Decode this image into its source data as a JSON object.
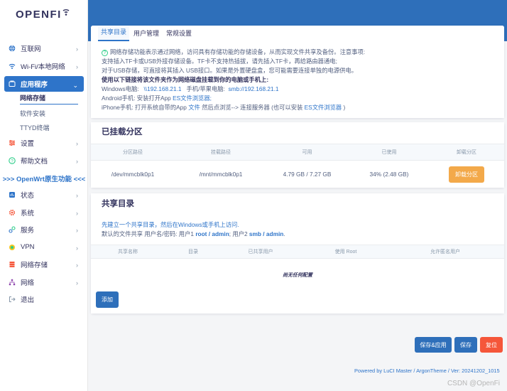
{
  "brand": {
    "name": "OPENFI"
  },
  "sidebar": {
    "items_top": [
      {
        "label": "互联网",
        "icon": "globe-icon"
      },
      {
        "label": "Wi-Fi/本地网络",
        "icon": "wifi-icon"
      }
    ],
    "active": {
      "label": "应用程序",
      "icon": "app-icon"
    },
    "sub_items": [
      {
        "label": "网络存储",
        "current": true
      },
      {
        "label": "软件安装"
      },
      {
        "label": "TTYD终端"
      }
    ],
    "items_mid": [
      {
        "label": "设置",
        "icon": "settings-icon"
      },
      {
        "label": "帮助文档",
        "icon": "help-icon"
      }
    ],
    "native_divider": ">>> OpenWrt原生功能 <<<",
    "items_native": [
      {
        "label": "状态",
        "icon": "status-icon"
      },
      {
        "label": "系统",
        "icon": "system-icon"
      },
      {
        "label": "服务",
        "icon": "services-icon"
      },
      {
        "label": "VPN",
        "icon": "vpn-icon"
      },
      {
        "label": "网络存储",
        "icon": "storage-icon"
      },
      {
        "label": "网络",
        "icon": "network-icon"
      },
      {
        "label": "退出",
        "icon": "logout-icon"
      }
    ]
  },
  "tabs": [
    "共享目录",
    "用户管理",
    "常规设置"
  ],
  "notice": {
    "line1": "网络存储功能表示通过网络，访问具有存储功能的存储设备，从而实现文件共享及备份。注意事项:",
    "line2": "支持插入TF卡或USB外接存储设备。TF卡不支持热插拔，请先插入TF卡，再给路由器通电;",
    "line3": "对于USB存储，可直接将其插入 USB接口。如果是外置硬盘盒，您可能需要连接单独的电源供电。",
    "line4": "使用以下链接将该文件夹作为网络磁盘挂载到你的电脑或手机上:",
    "win_label": "Windows电脑:",
    "win_path": "\\\\192.168.21.1",
    "phone_label": "手机/苹果电脑:",
    "phone_path": "smb://192.168.21.1",
    "android_prefix": "Android手机: 安装打开App",
    "android_link": "ES文件浏览器;",
    "iphone_prefix": "iPhone手机: 打开系统自带的App",
    "iphone_app": "文件",
    "iphone_mid": "然后点浏览--> 连接服务器 (也可以安装",
    "iphone_link": "ES文件浏览器",
    "iphone_end": ")"
  },
  "mounted": {
    "title": "已挂载分区",
    "headers": [
      "分区路径",
      "挂载路径",
      "可用",
      "已使用",
      "卸载分区"
    ],
    "rows": [
      {
        "device": "/dev/mmcblk0p1",
        "mount": "/mnt/mmcblk0p1",
        "available": "4.79 GB / 7.27 GB",
        "used": "34% (2.48 GB)",
        "action": "卸载分区"
      }
    ]
  },
  "share": {
    "title": "共享目录",
    "intro1": "先建立一个共享目录，然后在Windows或手机上访问.",
    "intro2_prefix": "默认的文件共享 用户名/密码: 用户1 ",
    "user1": "root / admin",
    "intro2_mid": "; 用户2 ",
    "user2": "smb / admin",
    "intro2_end": ".",
    "headers": [
      "共享名称",
      "目录",
      "已共享用户",
      "使用 Root",
      "允许匿名用户"
    ],
    "empty": "尚无任何配置",
    "add": "添加"
  },
  "actions": {
    "save_apply": "保存&应用",
    "save": "保存",
    "reset": "复位"
  },
  "footer": "Powered by LuCI Master / ArgonTheme / Ver: 20241202_1015",
  "watermark": "CSDN @OpenFi",
  "colors": {
    "primary": "#2e6fba",
    "warning": "#f3a94a",
    "danger": "#f5563a"
  }
}
